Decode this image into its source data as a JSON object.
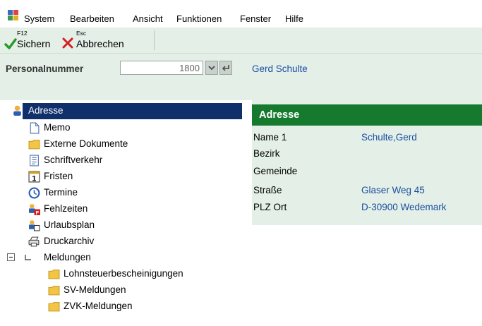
{
  "menu": [
    "System",
    "Bearbeiten",
    "Ansicht",
    "Funktionen",
    "Fenster",
    "Hilfe"
  ],
  "toolbar": {
    "save": {
      "key": "F12",
      "label": "Sichern"
    },
    "cancel": {
      "key": "Esc",
      "label": "Abbrechen"
    }
  },
  "personal": {
    "label": "Personalnummer",
    "number": "1800",
    "name": "Gerd Schulte"
  },
  "tree": {
    "items": [
      {
        "label": "Adresse",
        "icon": "person-icon"
      },
      {
        "label": "Memo",
        "icon": "memo-icon"
      },
      {
        "label": "Externe Dokumente",
        "icon": "folder-icon"
      },
      {
        "label": "Schriftverkehr",
        "icon": "document-icon"
      },
      {
        "label": "Fristen",
        "icon": "calendar-icon"
      },
      {
        "label": "Termine",
        "icon": "clock-icon"
      },
      {
        "label": "Fehlzeiten",
        "icon": "absence-icon"
      },
      {
        "label": "Urlaubsplan",
        "icon": "vacation-icon"
      },
      {
        "label": "Druckarchiv",
        "icon": "printer-icon"
      },
      {
        "label": "Meldungen",
        "icon": "expand-minus-icon"
      },
      {
        "label": "Lohnsteuerbescheinigungen",
        "icon": "folder-icon"
      },
      {
        "label": "SV-Meldungen",
        "icon": "folder-icon"
      },
      {
        "label": "ZVK-Meldungen",
        "icon": "folder-icon"
      }
    ]
  },
  "detail": {
    "title": "Adresse",
    "fields": [
      {
        "label": "Name 1",
        "value": "Schulte,Gerd"
      },
      {
        "label": "Bezirk",
        "value": ""
      },
      {
        "label": "Gemeinde",
        "value": ""
      },
      {
        "label": "Straße",
        "value": "Glaser Weg 45"
      },
      {
        "label": "PLZ Ort",
        "value": "D-30900 Wedemark"
      }
    ]
  },
  "colors": {
    "panel": "#e4efe8",
    "header_green": "#157a2e",
    "selection": "#10306b",
    "link_blue": "#1a4fa0"
  }
}
